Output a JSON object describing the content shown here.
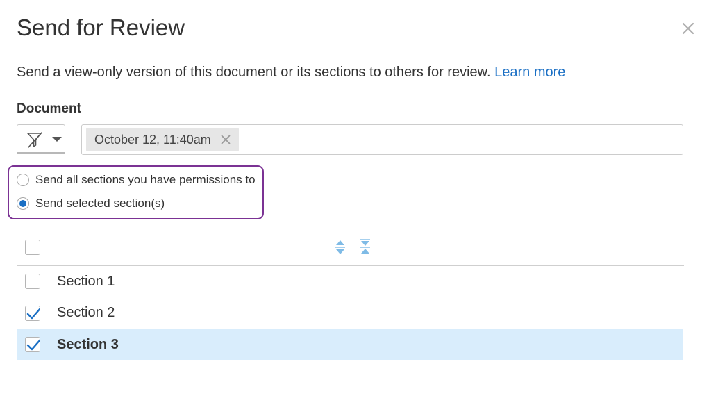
{
  "dialog": {
    "title": "Send for Review",
    "description": "Send a view-only version of this document or its sections to others for review.",
    "learn_more": "Learn more"
  },
  "document": {
    "label": "Document",
    "filter_icon": "filter-off-icon",
    "selected_version": "October 12, 11:40am"
  },
  "options": [
    {
      "label": "Send all sections you have permissions to",
      "checked": false
    },
    {
      "label": "Send selected section(s)",
      "checked": true
    }
  ],
  "sections": [
    {
      "label": "Section 1",
      "checked": false,
      "highlighted": false
    },
    {
      "label": "Section 2",
      "checked": true,
      "highlighted": false
    },
    {
      "label": "Section 3",
      "checked": true,
      "highlighted": true
    }
  ],
  "colors": {
    "accent": "#1a6fc4",
    "focus_ring": "#7b3294",
    "row_highlight": "#d9edfc",
    "sort_icons": "#7fbbe6"
  }
}
